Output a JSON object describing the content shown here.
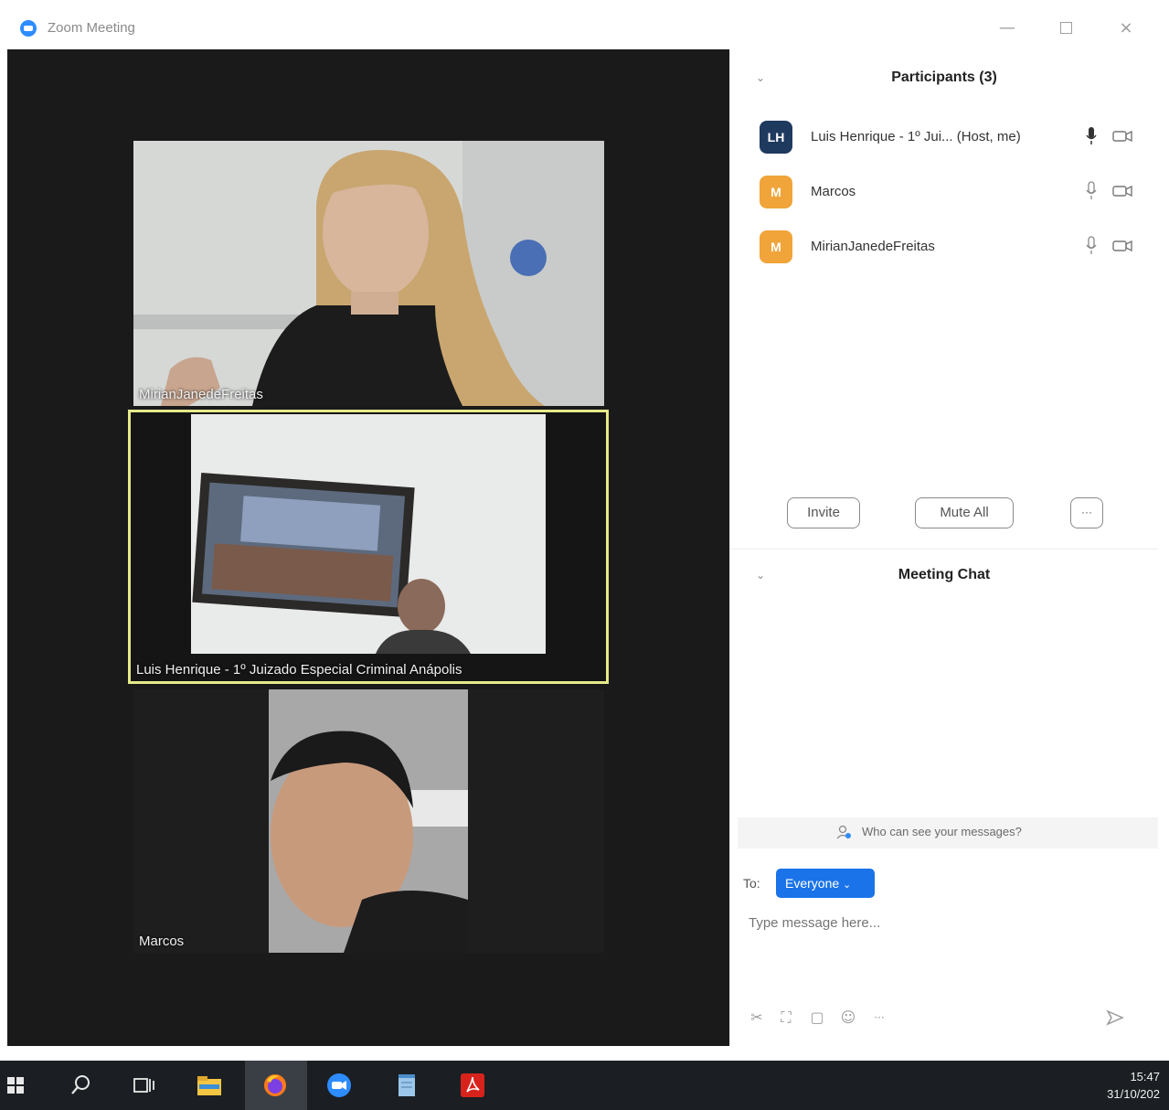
{
  "window": {
    "title": "Zoom Meeting",
    "min": "—",
    "close": "×"
  },
  "tiles": {
    "mirian": "MirianJanedeFreitas",
    "luis": "Luis Henrique - 1º Juizado Especial Criminal Anápolis",
    "marcos": "Marcos"
  },
  "participants": {
    "title": "Participants (3)",
    "items": [
      {
        "initials": "LH",
        "name": "Luis Henrique - 1º Jui... (Host, me)",
        "color": "#1f3a5f"
      },
      {
        "initials": "M",
        "name": "Marcos",
        "color": "#f0a43a"
      },
      {
        "initials": "M",
        "name": "MirianJanedeFreitas",
        "color": "#f0a43a"
      }
    ],
    "invite": "Invite",
    "mute_all": "Mute All",
    "more": "···"
  },
  "chat": {
    "title": "Meeting Chat",
    "who_can_see": "Who can see your messages?",
    "to_label": "To:",
    "recipient": "Everyone",
    "placeholder": "Type message here...",
    "more_tools": "···"
  },
  "taskbar": {
    "time": "15:47",
    "date": "31/10/202"
  },
  "colors": {
    "active_speaker_border": "#e5ea8a",
    "zoom_blue": "#2d8cff",
    "everyone_button": "#1a73e8"
  }
}
